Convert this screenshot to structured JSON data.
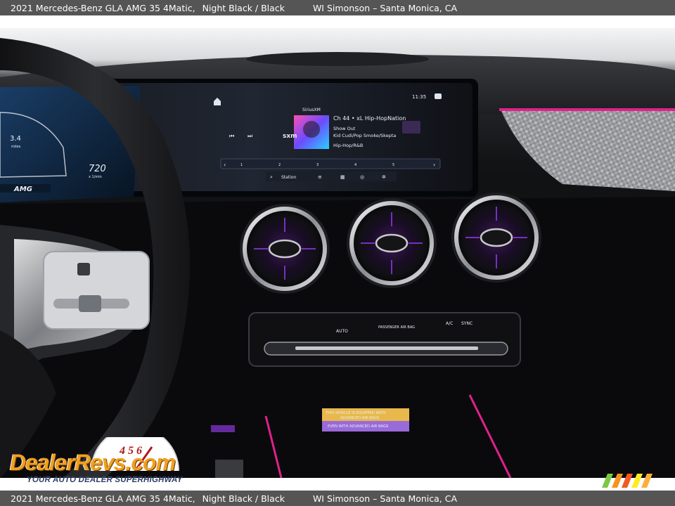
{
  "caption": {
    "vehicle": "2021 Mercedes-Benz GLA AMG 35 4Matic,",
    "color": "Night Black / Black",
    "dealer": "WI Simonson – Santa Monica, CA"
  },
  "watermark": {
    "brand": "DealerRevs.com",
    "tagline": "YOUR AUTO DEALER SUPERHIGHWAY",
    "speedometer_digits": "4 5 6"
  },
  "infotainment": {
    "time": "11:35",
    "channel": "Ch 44 • xL Hip-HopNation",
    "station_logo": "SiriusXM",
    "track": "Show Out",
    "artist": "Kid Cudi/Pop Smoke/Skepta",
    "genre": "Hip-Hop/R&B",
    "station_button": "Station",
    "presets": [
      "1",
      "2",
      "3",
      "4",
      "5"
    ]
  },
  "cluster": {
    "temp_value": "3.4",
    "temp_unit": "miles",
    "speed_value": "720",
    "speed_unit": "x 1/min",
    "brand": "AMG"
  },
  "climate": {
    "labels": [
      "AUTO",
      "PASSENGER AIR BAG",
      "A/C",
      "SYNC"
    ]
  },
  "airbag_label": {
    "line1": "THIS VEHICLE IS EQUIPPED WITH",
    "line2": "ADVANCED AIR BAGS",
    "line3": "EVEN WITH ADVANCED AIR BAGS"
  },
  "colors": {
    "ambient_pink": "#e0218a",
    "ambient_purple": "#a040ff",
    "caption_bg": "#555555",
    "logo_orange": "#f0a020",
    "logo_navy": "#2f3f66"
  }
}
